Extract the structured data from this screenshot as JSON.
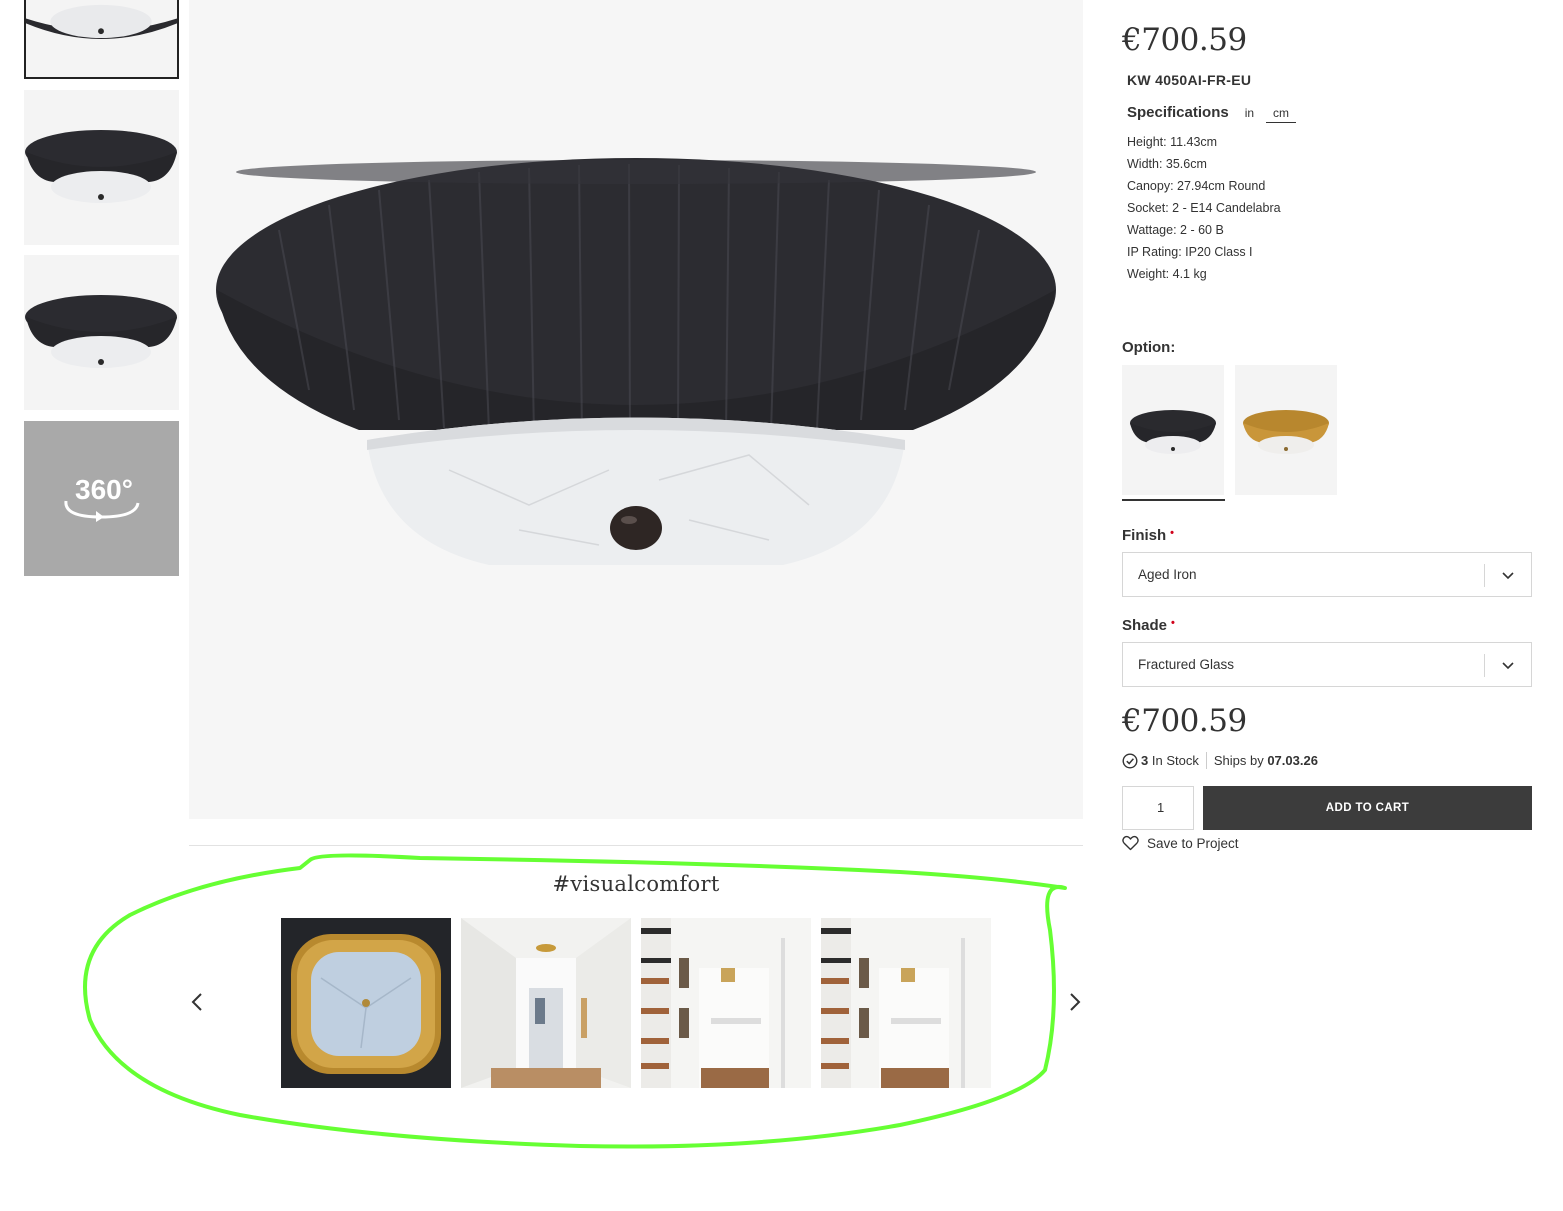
{
  "product": {
    "price": "€700.59",
    "sku": "KW 4050AI-FR-EU",
    "specifications": {
      "title": "Specifications",
      "unit_in": "in",
      "unit_cm": "cm",
      "selected_unit": "cm",
      "items": [
        "Height: 11.43cm",
        "Width: 35.6cm",
        "Canopy: 27.94cm Round",
        "Socket: 2 - E14 Candelabra",
        "Wattage: 2 - 60 B",
        "IP Rating: IP20 Class I",
        "Weight: 4.1 kg"
      ]
    },
    "option": {
      "label": "Option:",
      "swatches": [
        "aged-iron-swatch",
        "gild-swatch"
      ],
      "selected_index": 0
    },
    "finish": {
      "label": "Finish",
      "required_mark": "•",
      "value": "Aged Iron"
    },
    "shade": {
      "label": "Shade",
      "required_mark": "•",
      "value": "Fractured Glass"
    },
    "stock": {
      "count": "3",
      "label": "In Stock",
      "ships_label": "Ships by",
      "ships_date": "07.03.26"
    },
    "quantity": "1",
    "add_to_cart": "ADD TO CART",
    "save_to_project": "Save to Project"
  },
  "thumbnails": {
    "items": [
      "front-view",
      "side-view",
      "angle-view",
      "360-view"
    ],
    "selected_index": 0,
    "label_360": "360°"
  },
  "gallery": {
    "hashtag": "#visualcomfort",
    "tiles": [
      "fixture-closeup",
      "hallway-photo",
      "staircase-photo",
      "staircase-photo-2"
    ]
  },
  "colors": {
    "accent_dark": "#3c3c3c",
    "required": "#d0021b",
    "annotation": "#66ff33",
    "finish_dark": "#2a2a2e",
    "finish_gold": "#c9963a"
  }
}
